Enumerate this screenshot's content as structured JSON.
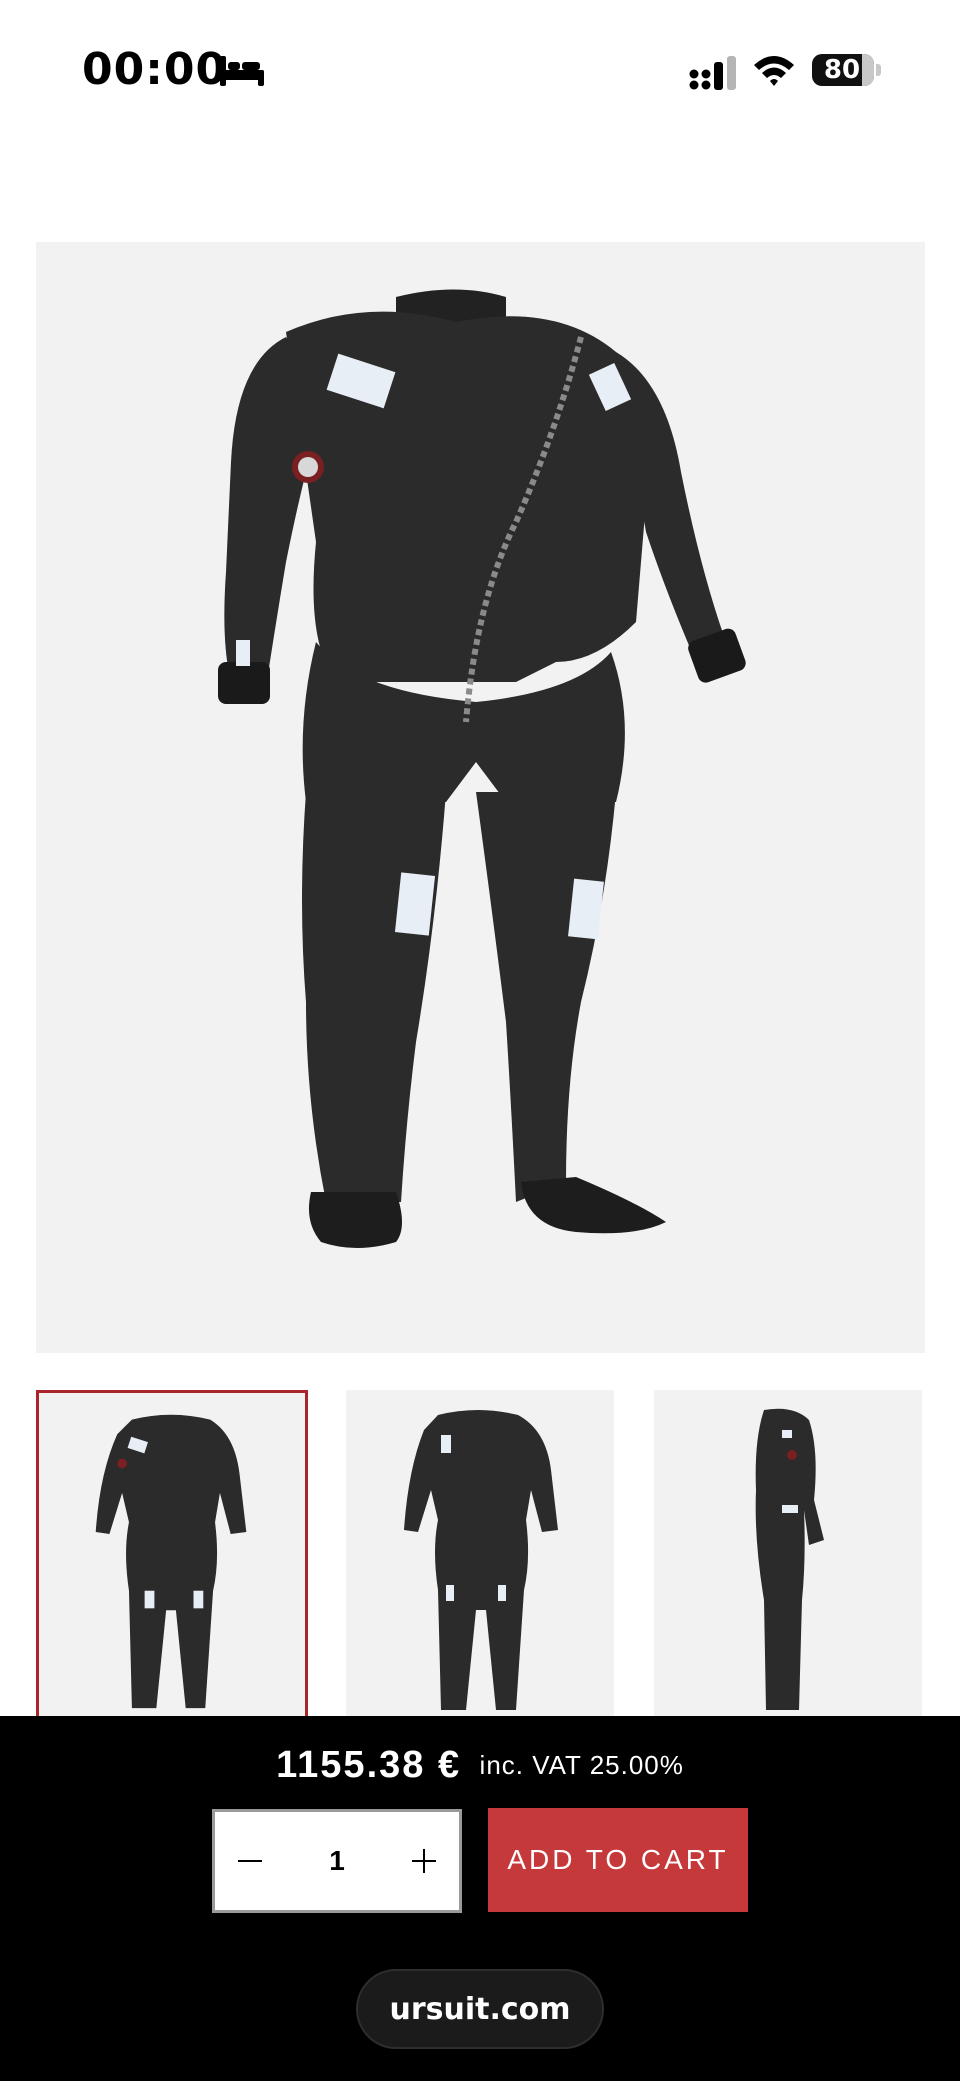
{
  "status_bar": {
    "time": "00:00",
    "battery": "80",
    "icons": [
      "sleep-icon",
      "signal-icon",
      "wifi-icon",
      "battery-icon"
    ]
  },
  "product": {
    "main_image_alt": "dry suit front view",
    "thumbnails": [
      {
        "icon": "drysuit-front-thumbnail",
        "selected": true
      },
      {
        "icon": "drysuit-front-angled-thumbnail",
        "selected": false
      },
      {
        "icon": "drysuit-side-thumbnail",
        "selected": false
      }
    ]
  },
  "buy_bar": {
    "price": "1155.38 €",
    "vat_text": "inc. VAT 25.00%",
    "quantity": "1",
    "minus_label": "−",
    "plus_label": "+",
    "add_to_cart_label": "ADD TO CART"
  },
  "browser": {
    "url": "ursuit.com"
  },
  "colors": {
    "accent_red": "#c6393b",
    "selected_border": "#a8252a",
    "buy_bar_bg": "#000000",
    "image_bg": "#f2f2f2"
  }
}
